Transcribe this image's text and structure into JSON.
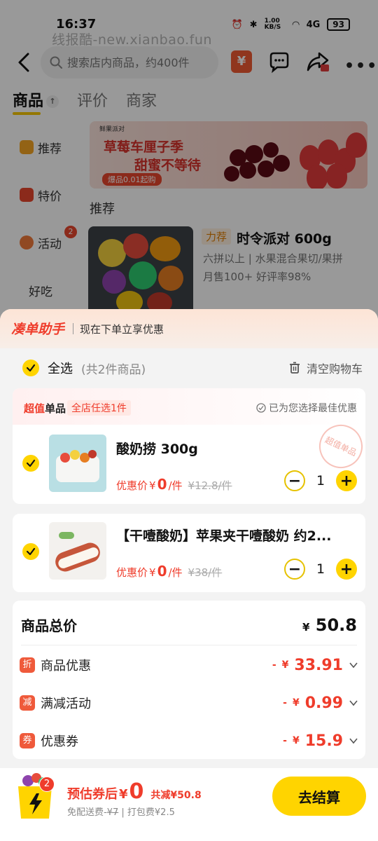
{
  "status": {
    "time": "16:37",
    "network_speed": "1.00 KB/S",
    "network_type": "4G",
    "battery": "93"
  },
  "watermark": "线报酷-new.xianbao.fun",
  "search": {
    "placeholder": "搜索店内商品，约400件"
  },
  "tabs": [
    {
      "label": "商品"
    },
    {
      "label": "评价"
    },
    {
      "label": "商家"
    }
  ],
  "side_nav": {
    "items": [
      {
        "label": "推荐"
      },
      {
        "label": "特价"
      },
      {
        "label": "活动",
        "badge": "2"
      },
      {
        "label": "好吃"
      }
    ]
  },
  "banner": {
    "brand": "鲜果派对",
    "title": "草莓车厘子季",
    "subtitle": "甜蜜不等待",
    "tag": "爆品0.01起购"
  },
  "recommend": {
    "title": "推荐",
    "product": {
      "tag": "力荐",
      "name": "时令派对 600g",
      "desc": "六拼以上 | 水果混合果切/果拼",
      "meta": "月售100+  好评率98%"
    }
  },
  "sheet": {
    "helper_logo": "凑单助手",
    "helper_text": "现在下单立享优惠",
    "select_all": "全选",
    "select_count": "(共2件商品)",
    "clear_cart": "清空购物车",
    "deal": {
      "label_red": "超值",
      "label_black": "单品",
      "range": "全店任选1件",
      "best": "已为您选择最佳优惠",
      "stamp": "超值单品"
    },
    "items": [
      {
        "name": "酸奶捞 300g",
        "price_label": "优惠价",
        "currency": "¥",
        "price": "0",
        "unit": "/件",
        "original_price": "¥12.8/件",
        "qty": "1"
      },
      {
        "name": "【干噎酸奶】苹果夹干噎酸奶 约2...",
        "price_label": "优惠价",
        "currency": "¥",
        "price": "0",
        "unit": "/件",
        "original_price": "¥38/件",
        "qty": "1"
      }
    ],
    "summary": {
      "total_label": "商品总价",
      "currency": "¥",
      "total_value": "50.8",
      "discounts": [
        {
          "icon": "折",
          "label": "商品优惠",
          "prefix": "-",
          "currency": "¥",
          "value": "33.91"
        },
        {
          "icon": "减",
          "label": "满减活动",
          "prefix": "-",
          "currency": "¥",
          "value": "0.99"
        },
        {
          "icon": "券",
          "label": "优惠券",
          "prefix": "-",
          "currency": "¥",
          "value": "15.9"
        }
      ]
    }
  },
  "bottom_bar": {
    "cart_badge": "2",
    "est_label": "预估券后",
    "est_currency": "¥",
    "est_value": "0",
    "saved": "共减¥50.8",
    "fee_prefix": "免配送费-",
    "fee_original": "¥7",
    "fee_suffix": "| 打包费¥2.5",
    "checkout_label": "去结算"
  },
  "colors": {
    "accent_yellow": "#ffd400",
    "price_red": "#ef3c2b"
  }
}
